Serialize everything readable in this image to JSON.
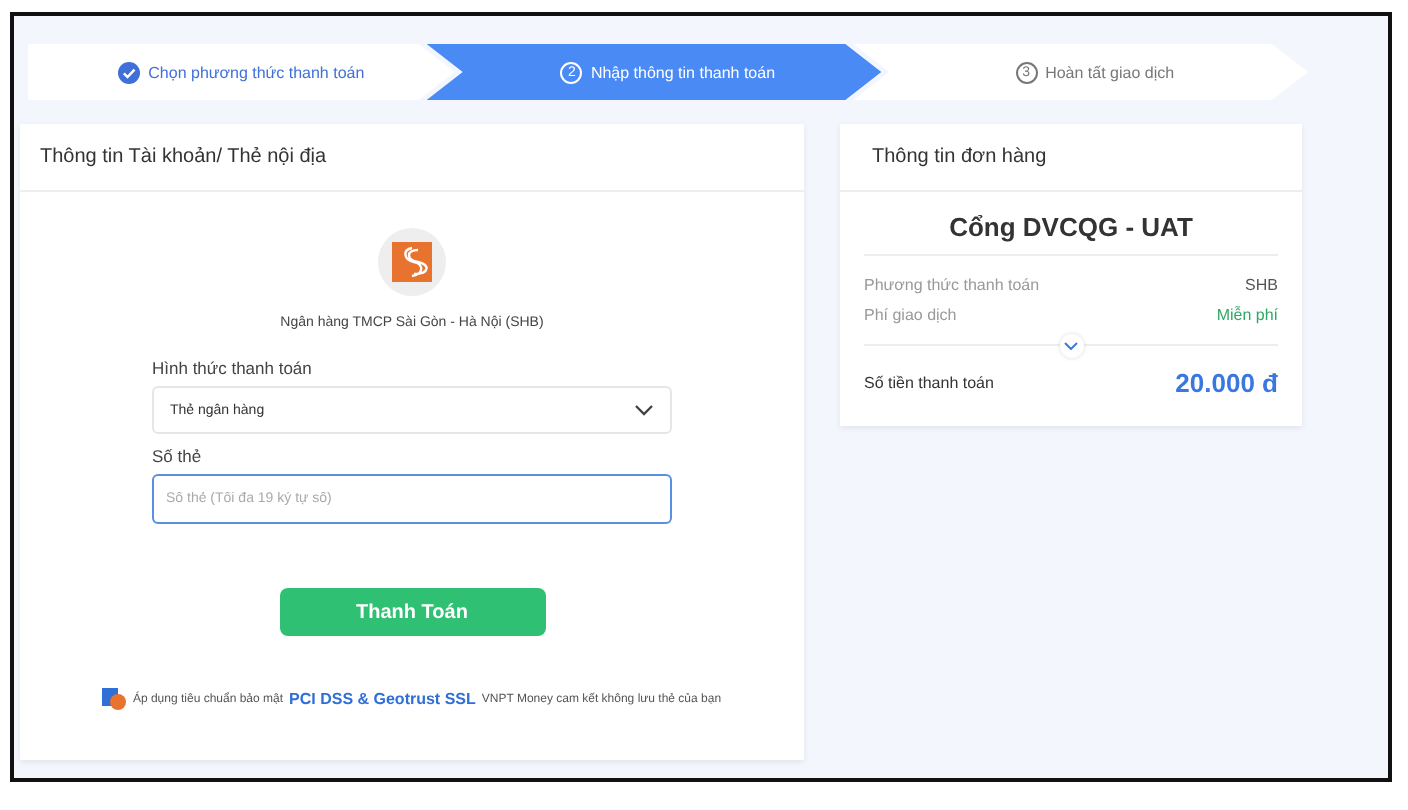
{
  "steps": [
    {
      "done": true,
      "selected": false,
      "label": "Chọn phương thức thanh toán"
    },
    {
      "done": false,
      "selected": true,
      "number": "2",
      "label": "Nhập thông tin thanh toán"
    },
    {
      "done": false,
      "selected": false,
      "number": "3",
      "label": "Hoàn tất giao dịch"
    }
  ],
  "account_card": {
    "title": "Thông tin Tài khoản/ Thẻ nội địa",
    "bank_name": "Ngân hàng TMCP Sài Gòn - Hà Nội (SHB)",
    "payment_type": {
      "label": "Hình thức thanh toán",
      "value": "Thẻ ngân hàng"
    },
    "card_number": {
      "label": "Số thẻ",
      "placeholder": "Số thẻ (Tối đa 19 ký tự số)"
    },
    "submit": "Thanh Toán",
    "security_note": {
      "before": "Áp dụng tiêu chuẩn bảo mật",
      "link": "PCI DSS & Geotrust SSL",
      "after": "VNPT Money cam kết không lưu thẻ của bạn"
    }
  },
  "order_card": {
    "title": "Thông tin đơn hàng",
    "merchant": "Cổng DVCQG - UAT",
    "rows": [
      {
        "kind": "plain",
        "label": "Phương thức thanh toán",
        "value": "SHB"
      },
      {
        "kind": "free",
        "label": "Phí giao dịch",
        "value": "Miễn phí"
      }
    ],
    "total": {
      "label": "Số tiền thanh toán",
      "value": "20.000 đ"
    }
  }
}
